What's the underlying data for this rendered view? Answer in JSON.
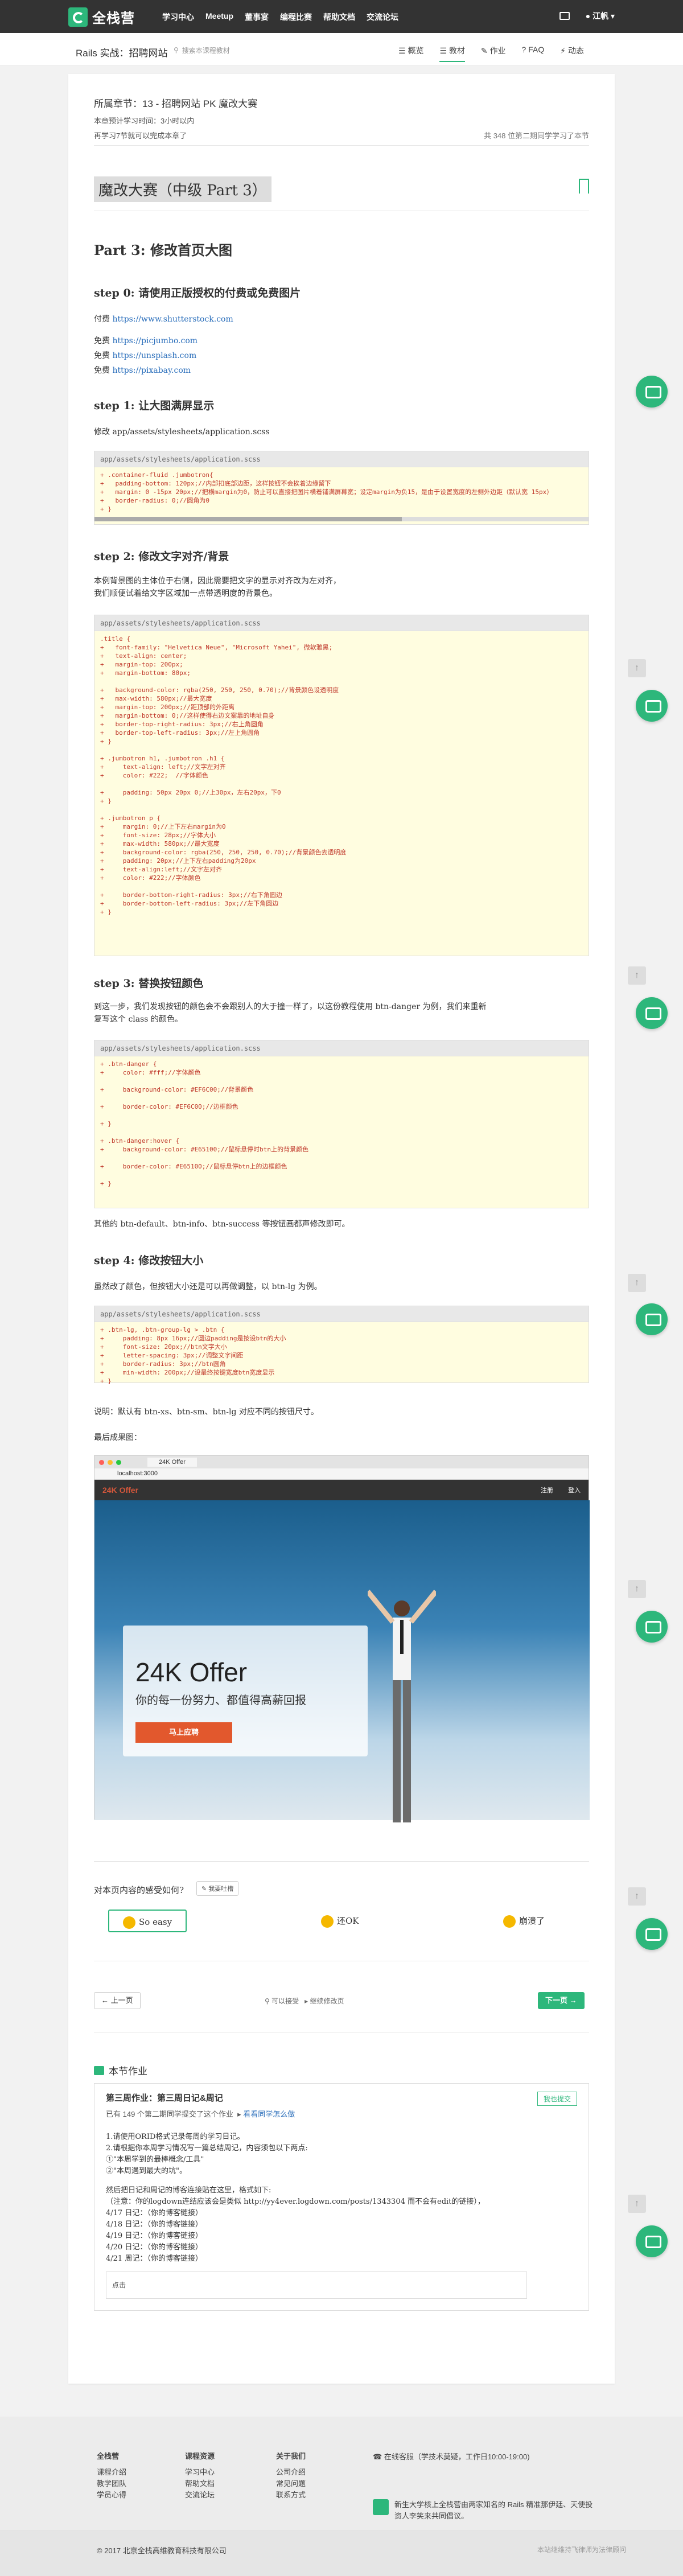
{
  "nav": {
    "logo": "全栈营",
    "menu": [
      "学习中心",
      "Meetup",
      "董事宴",
      "编程比赛",
      "帮助文档",
      "交流论坛"
    ],
    "user": "江帆"
  },
  "subnav": {
    "crumb": "Rails 实战：招聘网站",
    "search_placeholder": "搜索本课程教材",
    "tabs": [
      "概览",
      "教材",
      "作业",
      "FAQ",
      "动态"
    ]
  },
  "chapter": {
    "title": "所属章节：13 - 招聘网站 PK 魔改大赛",
    "time": "本章预计学习时间：3小时以内",
    "remain": "再学习7节就可以完成本章了",
    "peer": "共 348 位第二期同学学习了本节"
  },
  "title": "魔改大赛（中级 Part 3）",
  "part": "Part 3: 修改首页大图",
  "step0": {
    "heading": "step 0: 请使用正版授权的付费或免费图片",
    "paid_label": "付费 ",
    "paid_url": "https://www.shutterstock.com",
    "free": [
      {
        "label": "免费 ",
        "url": "https://picjumbo.com"
      },
      {
        "label": "免费 ",
        "url": "https://unsplash.com"
      },
      {
        "label": "免费 ",
        "url": "https://pixabay.com"
      }
    ]
  },
  "step1": {
    "heading": "step 1: 让大图满屏显示",
    "desc": "修改 app/assets/stylesheets/application.scss",
    "file": "app/assets/stylesheets/application.scss",
    "code": "+ .container-fluid .jumbotron{\n+   padding-bottom: 120px;//内部扣底部边距，这样按钮不会挨着边缘留下\n+   margin: 0 -15px 20px;//把横margin为0，防止可以直接把图片横着铺满屏幕宽；设定margin为负15，是由于设置宽度的左侧外边距（默认宽 15px）\n+   border-radius: 0;//圆角为0\n+ }"
  },
  "step2": {
    "heading": "step 2: 修改文字对齐/背景",
    "desc1": "本例背景图的主体位于右侧，因此需要把文字的显示对齐改为左对齐，",
    "desc2": "我们顺便试着给文字区域加一点带透明度的背景色。",
    "file": "app/assets/stylesheets/application.scss",
    "code": ".title {\n+   font-family: \"Helvetica Neue\", \"Microsoft Yahei\", 微软雅黑;\n+   text-align: center;\n+   margin-top: 200px;\n+   margin-bottom: 80px;\n\n+   background-color: rgba(250, 250, 250, 0.70);//背景颜色设透明度\n+   max-width: 580px;//最大宽度\n+   margin-top: 200px;//距顶部的外距离\n+   margin-bottom: 0;//这样使得右边文案靠的地址自身\n+   border-top-right-radius: 3px;//右上角圆角\n+   border-top-left-radius: 3px;//左上角圆角\n+ }\n\n+ .jumbotron h1, .jumbotron .h1 {\n+     text-align: left;//文字左对齐\n+     color: #222;  //字体颜色\n\n+     padding: 50px 20px 0;//上30px，左右20px，下0\n+ }\n\n+ .jumbotron p {\n+     margin: 0;//上下左右margin为0\n+     font-size: 28px;//字体大小\n+     max-width: 580px;//最大宽度\n+     background-color: rgba(250, 250, 250, 0.70);//背景颜色去透明度\n+     padding: 20px;//上下左右padding为20px\n+     text-align:left;//文字左对齐\n+     color: #222;//字体颜色\n\n+     border-bottom-right-radius: 3px;//右下角圆边\n+     border-bottom-left-radius: 3px;//左下角圆边\n+ }"
  },
  "step3": {
    "heading": "step 3: 替换按钮颜色",
    "desc1": "到这一步，我们发现按钮的颜色会不会跟别人的大于撞一样了，以这份教程使用 btn-danger 为例，我们来重新",
    "desc2": "复写这个 class 的颜色。",
    "file": "app/assets/stylesheets/application.scss",
    "code": "+ .btn-danger {\n+     color: #fff;//字体颜色\n\n+     background-color: #EF6C00;//背景颜色\n\n+     border-color: #EF6C00;//边框颜色\n\n+ }\n\n+ .btn-danger:hover {\n+     background-color: #E65100;//鼠标悬停时btn上的背景颜色\n\n+     border-color: #E65100;//鼠标悬停btn上的边框颜色\n\n+ }",
    "after": "其他的 btn-default、btn-info、btn-success 等按钮画都声修改即可。"
  },
  "step4": {
    "heading": "step 4: 修改按钮大小",
    "desc": "虽然改了颜色，但按钮大小还是可以再做调整，以 btn-lg 为例。",
    "file": "app/assets/stylesheets/application.scss",
    "code": "+ .btn-lg, .btn-group-lg > .btn {\n+     padding: 8px 16px;//圆边padding是按设btn的大小\n+     font-size: 20px;//btn文字大小\n+     letter-spacing: 3px;//调整文字间距\n+     border-radius: 3px;//btn圆角\n+     min-width: 200px;//设最终按键宽度btn宽度显示\n+ }",
    "note": "说明：默认有 btn-xs、btn-sm、btn-lg 对应不同的按钮尺寸。",
    "result": "最后成果图："
  },
  "screenshot": {
    "tab": "24K Offer",
    "url": "localhost:3000",
    "brand": "24K Offer",
    "links": [
      "注册",
      "登入"
    ],
    "headline": "24K Offer",
    "slogan": "你的每一份努力、都值得高薪回报",
    "button": "马上应聘"
  },
  "feedback": {
    "question": "对本页内容的感受如何?",
    "badge": "我要吐槽",
    "options": [
      "So easy",
      "还OK",
      "崩溃了"
    ]
  },
  "pager": {
    "prev": "上一页",
    "mid1": "可以接受",
    "mid2": "继续修改页",
    "next": "下一页"
  },
  "homework": {
    "section": "本节作业",
    "title": "第三周作业：第三周日记&周记",
    "sub": "已有 149 个第二期同学提交了这个作业",
    "sub_link": "看看同学怎么做",
    "btn": "我也提交",
    "lines": [
      "1.请使用ORID格式记录每周的学习日记。",
      "2.请根据你本周学习情况写一篇总结周记，内容须包以下两点:",
      "①\"本周学到的最棒概念/工具\"",
      "②\"本周遇到最大的坑\"。"
    ],
    "note1": "然后把日记和周记的博客连接贴在这里，格式如下:",
    "note2": "（注意：你的logdown连结应该会是类似 http://yy4ever.logdown.com/posts/1343304 而不会有edit的链接），",
    "days": [
      "4/17 日记：（你的博客链接）",
      "4/18 日记：（你的博客链接）",
      "4/19 日记：（你的博客链接）",
      "4/20 日记：（你的博客链接）",
      "4/21 周记：（你的博客链接）"
    ],
    "input": "点击"
  },
  "footer": {
    "cols": [
      {
        "title": "全栈营",
        "items": [
          "课程介绍",
          "教学团队",
          "学员心得"
        ]
      },
      {
        "title": "课程资源",
        "items": [
          "学习中心",
          "帮助文档",
          "交流论坛"
        ]
      },
      {
        "title": "关于我们",
        "items": [
          "公司介绍",
          "常见问题",
          "联系方式"
        ]
      }
    ],
    "service": "在线客服（学技术莫疑，工作日10:00-19:00)",
    "motto": "新生大学核上全栈营由两家知名的 Rails 精准那伊廷、天使投资人李笑来共同倡议。",
    "copyright": "© 2017 北京全栈高维教育科技有限公司",
    "icp": "本站继维持飞律师为法律顾问"
  },
  "colors": {
    "brand": "#2db77b",
    "code_bg": "#fffde0",
    "code_text": "#c0392b"
  }
}
